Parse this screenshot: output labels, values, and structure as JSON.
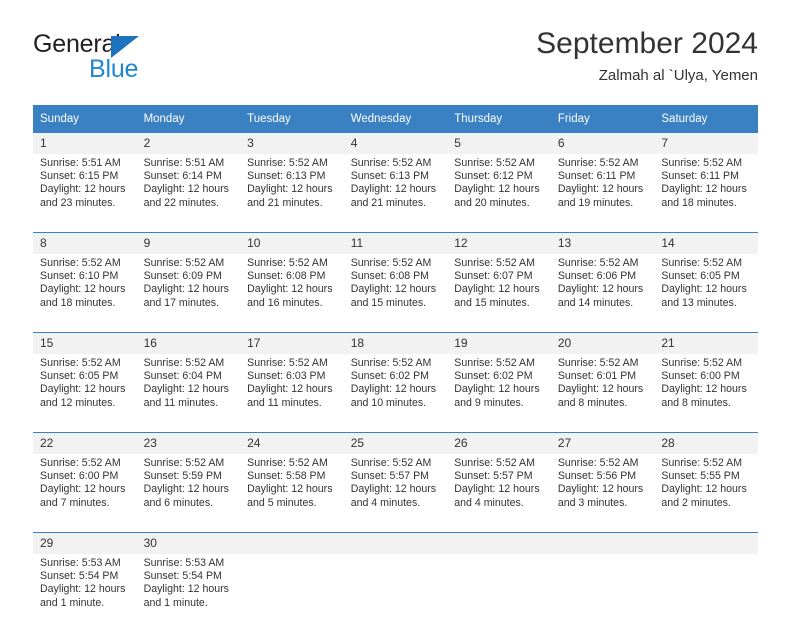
{
  "brand": {
    "name_part1": "General",
    "name_part2": "Blue",
    "accent_color": "#1f86d0",
    "triangle_color": "#1f72bd"
  },
  "header": {
    "title": "September 2024",
    "subtitle": "Zalmah al `Ulya, Yemen"
  },
  "theme": {
    "header_blue": "#3a81c4",
    "daynum_band": "#f2f2f2",
    "text": "#333333"
  },
  "calendar": {
    "day_headers": [
      "Sunday",
      "Monday",
      "Tuesday",
      "Wednesday",
      "Thursday",
      "Friday",
      "Saturday"
    ],
    "weeks": [
      [
        {
          "day": "1",
          "sunrise": "Sunrise: 5:51 AM",
          "sunset": "Sunset: 6:15 PM",
          "daylight1": "Daylight: 12 hours",
          "daylight2": "and 23 minutes."
        },
        {
          "day": "2",
          "sunrise": "Sunrise: 5:51 AM",
          "sunset": "Sunset: 6:14 PM",
          "daylight1": "Daylight: 12 hours",
          "daylight2": "and 22 minutes."
        },
        {
          "day": "3",
          "sunrise": "Sunrise: 5:52 AM",
          "sunset": "Sunset: 6:13 PM",
          "daylight1": "Daylight: 12 hours",
          "daylight2": "and 21 minutes."
        },
        {
          "day": "4",
          "sunrise": "Sunrise: 5:52 AM",
          "sunset": "Sunset: 6:13 PM",
          "daylight1": "Daylight: 12 hours",
          "daylight2": "and 21 minutes."
        },
        {
          "day": "5",
          "sunrise": "Sunrise: 5:52 AM",
          "sunset": "Sunset: 6:12 PM",
          "daylight1": "Daylight: 12 hours",
          "daylight2": "and 20 minutes."
        },
        {
          "day": "6",
          "sunrise": "Sunrise: 5:52 AM",
          "sunset": "Sunset: 6:11 PM",
          "daylight1": "Daylight: 12 hours",
          "daylight2": "and 19 minutes."
        },
        {
          "day": "7",
          "sunrise": "Sunrise: 5:52 AM",
          "sunset": "Sunset: 6:11 PM",
          "daylight1": "Daylight: 12 hours",
          "daylight2": "and 18 minutes."
        }
      ],
      [
        {
          "day": "8",
          "sunrise": "Sunrise: 5:52 AM",
          "sunset": "Sunset: 6:10 PM",
          "daylight1": "Daylight: 12 hours",
          "daylight2": "and 18 minutes."
        },
        {
          "day": "9",
          "sunrise": "Sunrise: 5:52 AM",
          "sunset": "Sunset: 6:09 PM",
          "daylight1": "Daylight: 12 hours",
          "daylight2": "and 17 minutes."
        },
        {
          "day": "10",
          "sunrise": "Sunrise: 5:52 AM",
          "sunset": "Sunset: 6:08 PM",
          "daylight1": "Daylight: 12 hours",
          "daylight2": "and 16 minutes."
        },
        {
          "day": "11",
          "sunrise": "Sunrise: 5:52 AM",
          "sunset": "Sunset: 6:08 PM",
          "daylight1": "Daylight: 12 hours",
          "daylight2": "and 15 minutes."
        },
        {
          "day": "12",
          "sunrise": "Sunrise: 5:52 AM",
          "sunset": "Sunset: 6:07 PM",
          "daylight1": "Daylight: 12 hours",
          "daylight2": "and 15 minutes."
        },
        {
          "day": "13",
          "sunrise": "Sunrise: 5:52 AM",
          "sunset": "Sunset: 6:06 PM",
          "daylight1": "Daylight: 12 hours",
          "daylight2": "and 14 minutes."
        },
        {
          "day": "14",
          "sunrise": "Sunrise: 5:52 AM",
          "sunset": "Sunset: 6:05 PM",
          "daylight1": "Daylight: 12 hours",
          "daylight2": "and 13 minutes."
        }
      ],
      [
        {
          "day": "15",
          "sunrise": "Sunrise: 5:52 AM",
          "sunset": "Sunset: 6:05 PM",
          "daylight1": "Daylight: 12 hours",
          "daylight2": "and 12 minutes."
        },
        {
          "day": "16",
          "sunrise": "Sunrise: 5:52 AM",
          "sunset": "Sunset: 6:04 PM",
          "daylight1": "Daylight: 12 hours",
          "daylight2": "and 11 minutes."
        },
        {
          "day": "17",
          "sunrise": "Sunrise: 5:52 AM",
          "sunset": "Sunset: 6:03 PM",
          "daylight1": "Daylight: 12 hours",
          "daylight2": "and 11 minutes."
        },
        {
          "day": "18",
          "sunrise": "Sunrise: 5:52 AM",
          "sunset": "Sunset: 6:02 PM",
          "daylight1": "Daylight: 12 hours",
          "daylight2": "and 10 minutes."
        },
        {
          "day": "19",
          "sunrise": "Sunrise: 5:52 AM",
          "sunset": "Sunset: 6:02 PM",
          "daylight1": "Daylight: 12 hours",
          "daylight2": "and 9 minutes."
        },
        {
          "day": "20",
          "sunrise": "Sunrise: 5:52 AM",
          "sunset": "Sunset: 6:01 PM",
          "daylight1": "Daylight: 12 hours",
          "daylight2": "and 8 minutes."
        },
        {
          "day": "21",
          "sunrise": "Sunrise: 5:52 AM",
          "sunset": "Sunset: 6:00 PM",
          "daylight1": "Daylight: 12 hours",
          "daylight2": "and 8 minutes."
        }
      ],
      [
        {
          "day": "22",
          "sunrise": "Sunrise: 5:52 AM",
          "sunset": "Sunset: 6:00 PM",
          "daylight1": "Daylight: 12 hours",
          "daylight2": "and 7 minutes."
        },
        {
          "day": "23",
          "sunrise": "Sunrise: 5:52 AM",
          "sunset": "Sunset: 5:59 PM",
          "daylight1": "Daylight: 12 hours",
          "daylight2": "and 6 minutes."
        },
        {
          "day": "24",
          "sunrise": "Sunrise: 5:52 AM",
          "sunset": "Sunset: 5:58 PM",
          "daylight1": "Daylight: 12 hours",
          "daylight2": "and 5 minutes."
        },
        {
          "day": "25",
          "sunrise": "Sunrise: 5:52 AM",
          "sunset": "Sunset: 5:57 PM",
          "daylight1": "Daylight: 12 hours",
          "daylight2": "and 4 minutes."
        },
        {
          "day": "26",
          "sunrise": "Sunrise: 5:52 AM",
          "sunset": "Sunset: 5:57 PM",
          "daylight1": "Daylight: 12 hours",
          "daylight2": "and 4 minutes."
        },
        {
          "day": "27",
          "sunrise": "Sunrise: 5:52 AM",
          "sunset": "Sunset: 5:56 PM",
          "daylight1": "Daylight: 12 hours",
          "daylight2": "and 3 minutes."
        },
        {
          "day": "28",
          "sunrise": "Sunrise: 5:52 AM",
          "sunset": "Sunset: 5:55 PM",
          "daylight1": "Daylight: 12 hours",
          "daylight2": "and 2 minutes."
        }
      ],
      [
        {
          "day": "29",
          "sunrise": "Sunrise: 5:53 AM",
          "sunset": "Sunset: 5:54 PM",
          "daylight1": "Daylight: 12 hours",
          "daylight2": "and 1 minute."
        },
        {
          "day": "30",
          "sunrise": "Sunrise: 5:53 AM",
          "sunset": "Sunset: 5:54 PM",
          "daylight1": "Daylight: 12 hours",
          "daylight2": "and 1 minute."
        },
        {
          "day": "",
          "sunrise": "",
          "sunset": "",
          "daylight1": "",
          "daylight2": ""
        },
        {
          "day": "",
          "sunrise": "",
          "sunset": "",
          "daylight1": "",
          "daylight2": ""
        },
        {
          "day": "",
          "sunrise": "",
          "sunset": "",
          "daylight1": "",
          "daylight2": ""
        },
        {
          "day": "",
          "sunrise": "",
          "sunset": "",
          "daylight1": "",
          "daylight2": ""
        },
        {
          "day": "",
          "sunrise": "",
          "sunset": "",
          "daylight1": "",
          "daylight2": ""
        }
      ]
    ]
  }
}
